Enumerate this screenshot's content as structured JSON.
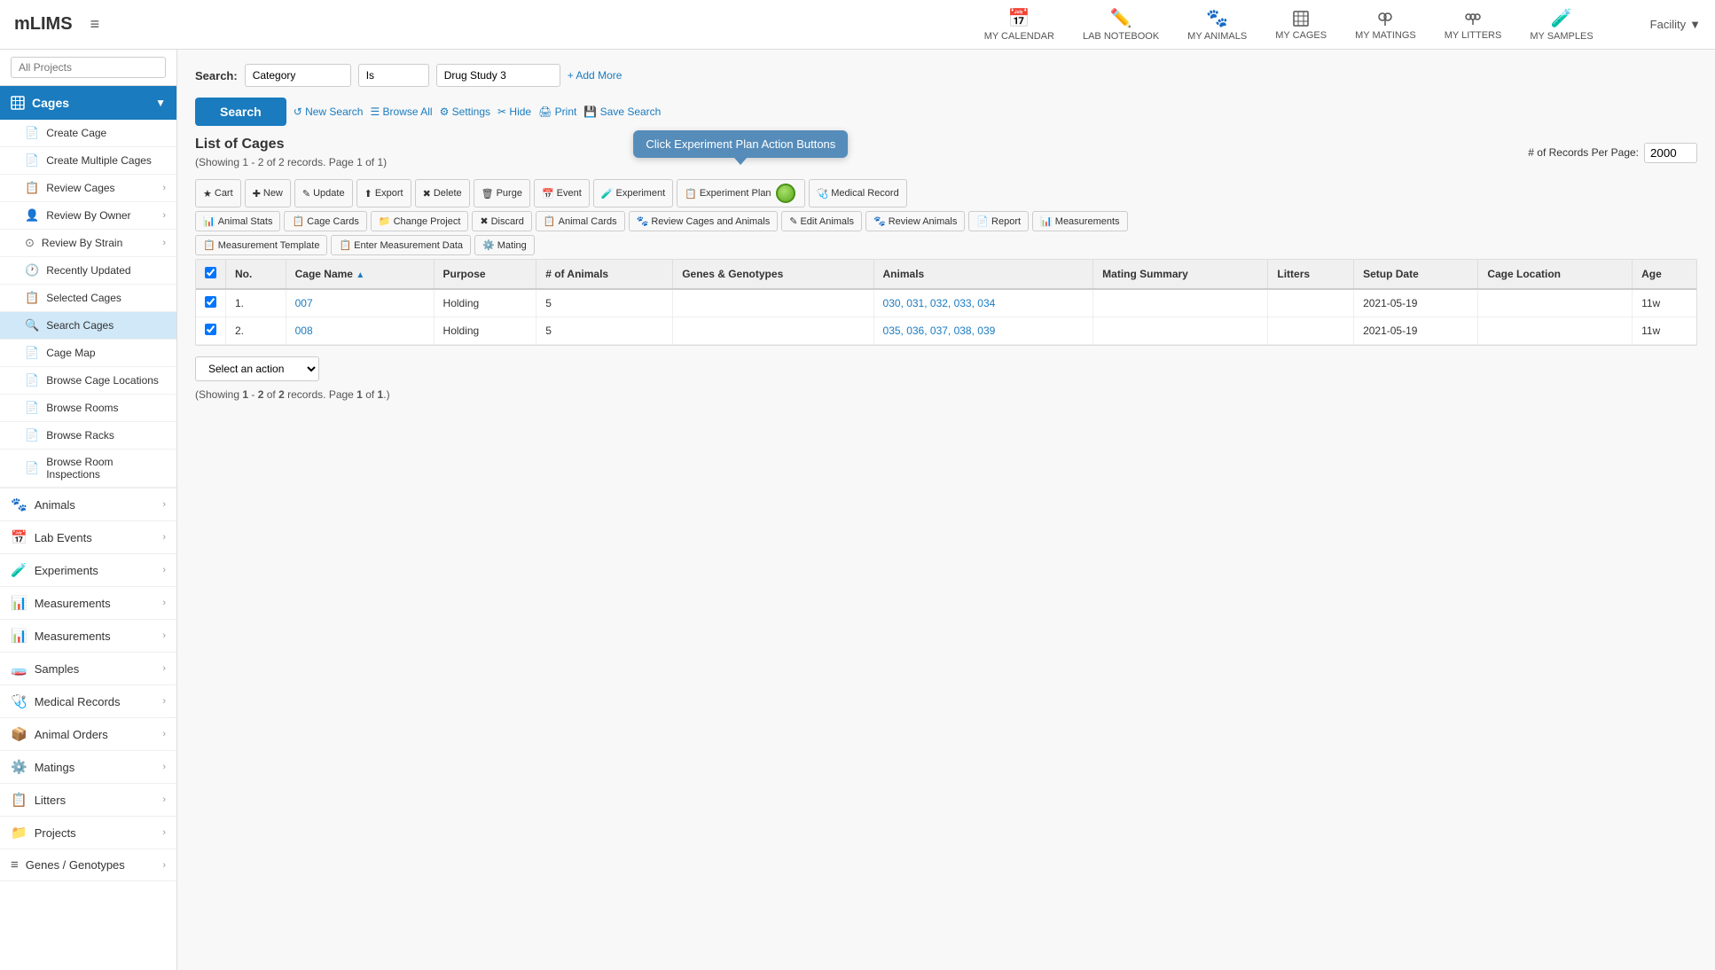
{
  "app": {
    "logo": "mLIMS",
    "menu_icon": "≡"
  },
  "top_nav": {
    "items": [
      {
        "id": "calendar",
        "icon": "📅",
        "label": "MY CALENDAR"
      },
      {
        "id": "lab_notebook",
        "icon": "✏️",
        "label": "LAB NOTEBOOK"
      },
      {
        "id": "my_animals",
        "icon": "🐾",
        "label": "MY ANIMALS"
      },
      {
        "id": "my_cages",
        "icon": "⬛",
        "label": "MY CAGES"
      },
      {
        "id": "my_matings",
        "icon": "⚙️",
        "label": "MY MATINGS"
      },
      {
        "id": "my_litters",
        "icon": "⚙️",
        "label": "MY LITTERS"
      },
      {
        "id": "my_samples",
        "icon": "🧪",
        "label": "MY SAMPLES"
      }
    ],
    "facility_label": "Facility"
  },
  "sidebar": {
    "project_placeholder": "All Projects",
    "cages_section": {
      "label": "Cages",
      "items": [
        {
          "id": "create-cage",
          "icon": "📄",
          "label": "Create Cage",
          "has_arrow": false
        },
        {
          "id": "create-multiple-cages",
          "icon": "📄",
          "label": "Create Multiple Cages",
          "has_arrow": false
        },
        {
          "id": "review-cages",
          "icon": "📋",
          "label": "Review Cages",
          "has_arrow": true
        },
        {
          "id": "review-by-owner",
          "icon": "👤",
          "label": "Review By Owner",
          "has_arrow": true
        },
        {
          "id": "review-by-strain",
          "icon": "⊙",
          "label": "Review By Strain",
          "has_arrow": true
        },
        {
          "id": "recently-updated",
          "icon": "🕐",
          "label": "Recently Updated",
          "has_arrow": false
        },
        {
          "id": "selected-cages",
          "icon": "📋",
          "label": "Selected Cages",
          "has_arrow": false
        },
        {
          "id": "search-cages",
          "icon": "🔍",
          "label": "Search Cages",
          "has_arrow": false,
          "active": true
        },
        {
          "id": "cage-map",
          "icon": "📄",
          "label": "Cage Map",
          "has_arrow": false
        },
        {
          "id": "browse-cage-locations",
          "icon": "📄",
          "label": "Browse Cage Locations",
          "has_arrow": false
        },
        {
          "id": "browse-rooms",
          "icon": "📄",
          "label": "Browse Rooms",
          "has_arrow": false
        },
        {
          "id": "browse-racks",
          "icon": "📄",
          "label": "Browse Racks",
          "has_arrow": false
        },
        {
          "id": "browse-room-inspections",
          "icon": "📄",
          "label": "Browse Room Inspections",
          "has_arrow": false
        }
      ]
    },
    "categories": [
      {
        "id": "animals",
        "icon": "🐾",
        "label": "Animals"
      },
      {
        "id": "lab-events",
        "icon": "📅",
        "label": "Lab Events"
      },
      {
        "id": "experiments",
        "icon": "🧪",
        "label": "Experiments"
      },
      {
        "id": "measurements1",
        "icon": "📊",
        "label": "Measurements"
      },
      {
        "id": "measurements2",
        "icon": "📊",
        "label": "Measurements"
      },
      {
        "id": "samples",
        "icon": "🧫",
        "label": "Samples"
      },
      {
        "id": "medical-records",
        "icon": "🩺",
        "label": "Medical Records"
      },
      {
        "id": "animal-orders",
        "icon": "📦",
        "label": "Animal Orders"
      },
      {
        "id": "matings",
        "icon": "⚙️",
        "label": "Matings"
      },
      {
        "id": "litters",
        "icon": "📋",
        "label": "Litters"
      },
      {
        "id": "projects",
        "icon": "📁",
        "label": "Projects"
      },
      {
        "id": "genes-genotypes",
        "icon": "≡",
        "label": "Genes / Genotypes"
      }
    ]
  },
  "search": {
    "label": "Search:",
    "field1_value": "Category",
    "field2_value": "Is",
    "field3_value": "Drug Study 3",
    "add_more_label": "+ Add More",
    "search_button_label": "Search",
    "new_search_label": "↺ New Search",
    "browse_all_label": "☰ Browse All",
    "settings_label": "⚙ Settings",
    "hide_label": "✂ Hide",
    "print_label": "🖨 Print",
    "save_search_label": "💾 Save Search"
  },
  "list": {
    "title": "List of Cages",
    "showing_text": "(Showing 1 - 2 of 2 records. Page 1 of 1)",
    "records_per_page_label": "# of Records Per Page:",
    "records_per_page_value": "2000",
    "tooltip_text": "Click Experiment Plan Action Buttons",
    "select_action_placeholder": "Select an action",
    "showing_bottom": "(Showing 1 - 2 of 2 records. Page 1 of 1.)",
    "action_buttons": [
      {
        "id": "cart",
        "icon": "★",
        "label": "Cart"
      },
      {
        "id": "new",
        "icon": "✚",
        "label": "New"
      },
      {
        "id": "update",
        "icon": "✎",
        "label": "Update"
      },
      {
        "id": "export",
        "icon": "⬆",
        "label": "Export"
      },
      {
        "id": "delete",
        "icon": "✖",
        "label": "Delete"
      },
      {
        "id": "purge",
        "icon": "🗑",
        "label": "Purge"
      },
      {
        "id": "event",
        "icon": "📅",
        "label": "Event"
      },
      {
        "id": "experiment",
        "icon": "🧪",
        "label": "Experiment"
      },
      {
        "id": "experiment-plan",
        "icon": "📋",
        "label": "Experiment Plan"
      },
      {
        "id": "medical-record",
        "icon": "🩺",
        "label": "Medical Record"
      }
    ],
    "action_buttons2": [
      {
        "id": "animal-stats",
        "icon": "📊",
        "label": "Animal Stats"
      },
      {
        "id": "cage-cards",
        "icon": "📋",
        "label": "Cage Cards"
      },
      {
        "id": "change-project",
        "icon": "📁",
        "label": "Change Project"
      },
      {
        "id": "discard",
        "icon": "✖",
        "label": "Discard"
      },
      {
        "id": "animal-cards",
        "icon": "📋",
        "label": "Animal Cards"
      },
      {
        "id": "review-cages-animals",
        "icon": "🐾",
        "label": "Review Cages and Animals"
      },
      {
        "id": "edit-animals",
        "icon": "✎",
        "label": "Edit Animals"
      },
      {
        "id": "review-animals",
        "icon": "🐾",
        "label": "Review Animals"
      },
      {
        "id": "report",
        "icon": "📄",
        "label": "Report"
      },
      {
        "id": "measurements",
        "icon": "📊",
        "label": "Measurements"
      }
    ],
    "action_buttons3": [
      {
        "id": "measurement-template",
        "icon": "📋",
        "label": "Measurement Template"
      },
      {
        "id": "enter-measurement-data",
        "icon": "📋",
        "label": "Enter Measurement Data"
      },
      {
        "id": "mating",
        "icon": "⚙️",
        "label": "Mating"
      }
    ],
    "columns": [
      {
        "id": "no",
        "label": "No."
      },
      {
        "id": "cage-name",
        "label": "Cage Name ▲"
      },
      {
        "id": "purpose",
        "label": "Purpose"
      },
      {
        "id": "num-animals",
        "label": "# of Animals"
      },
      {
        "id": "genes-genotypes",
        "label": "Genes & Genotypes"
      },
      {
        "id": "animals",
        "label": "Animals"
      },
      {
        "id": "mating-summary",
        "label": "Mating Summary"
      },
      {
        "id": "litters",
        "label": "Litters"
      },
      {
        "id": "setup-date",
        "label": "Setup Date"
      },
      {
        "id": "cage-location",
        "label": "Cage Location"
      },
      {
        "id": "age",
        "label": "Age"
      }
    ],
    "rows": [
      {
        "no": "1.",
        "cage_name": "007",
        "purpose": "Holding",
        "num_animals": "5",
        "genes_genotypes": "",
        "animals": "030, 031, 032, 033, 034",
        "mating_summary": "",
        "litters": "",
        "setup_date": "2021-05-19",
        "cage_location": "",
        "age": "11w",
        "checked": true
      },
      {
        "no": "2.",
        "cage_name": "008",
        "purpose": "Holding",
        "num_animals": "5",
        "genes_genotypes": "",
        "animals": "035, 036, 037, 038, 039",
        "mating_summary": "",
        "litters": "",
        "setup_date": "2021-05-19",
        "cage_location": "",
        "age": "11w",
        "checked": true
      }
    ]
  }
}
